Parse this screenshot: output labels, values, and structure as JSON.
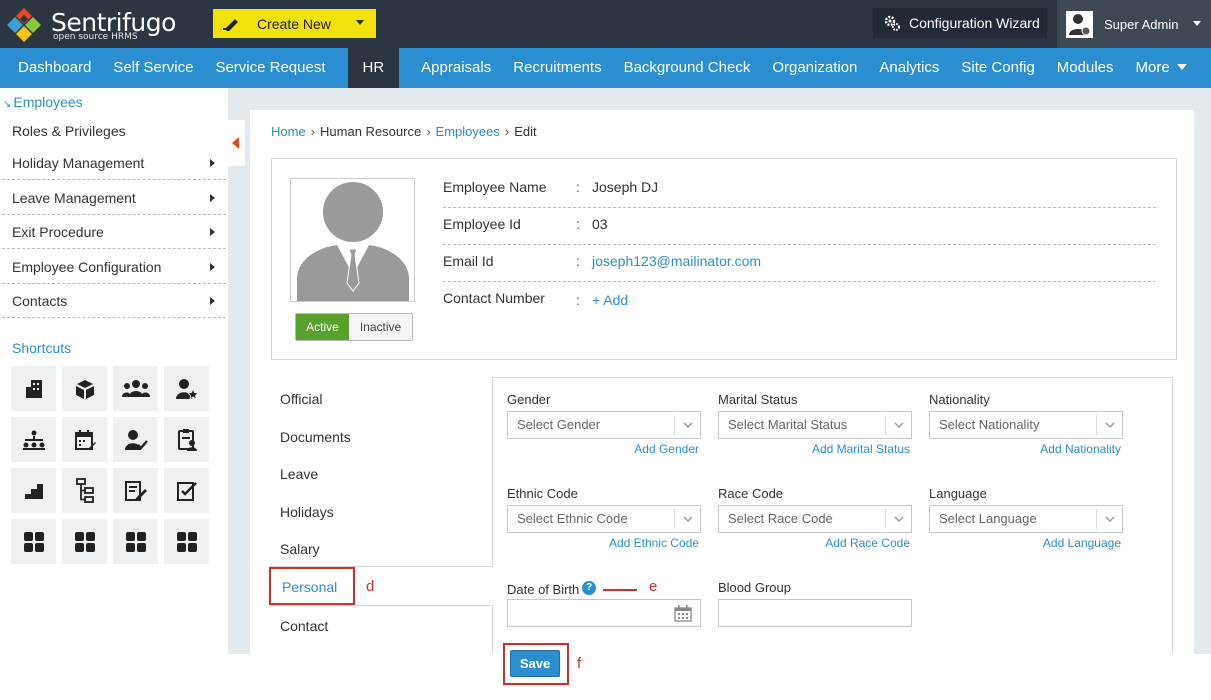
{
  "brand": {
    "name": "Sentrifugo",
    "tagline": "open source HRMS"
  },
  "header": {
    "create_new": "Create New",
    "config_wizard": "Configuration Wizard",
    "user_name": "Super Admin"
  },
  "nav": {
    "items": [
      "Dashboard",
      "Self Service",
      "Service Request",
      "HR",
      "Appraisals",
      "Recruitments",
      "Background Check",
      "Organization",
      "Analytics",
      "Site Config",
      "Modules",
      "More"
    ],
    "active": "HR"
  },
  "sidebar": {
    "section": "Employees",
    "items": [
      {
        "label": "Roles & Privileges",
        "has_submenu": false
      },
      {
        "label": "Holiday Management",
        "has_submenu": true
      },
      {
        "label": "Leave Management",
        "has_submenu": true
      },
      {
        "label": "Exit Procedure",
        "has_submenu": true
      },
      {
        "label": "Employee Configuration",
        "has_submenu": true
      },
      {
        "label": "Contacts",
        "has_submenu": true
      }
    ],
    "shortcuts_title": "Shortcuts",
    "shortcut_icons": [
      "building-icon",
      "boxes-icon",
      "group-icon",
      "user-star-icon",
      "org-chart-icon",
      "calendar-edit-icon",
      "user-check-icon",
      "clipboard-user-icon",
      "stairs-icon",
      "hierarchy-icon",
      "document-edit-icon",
      "checklist-icon",
      "grid-icon",
      "grid-icon",
      "grid-icon",
      "grid-icon"
    ]
  },
  "breadcrumb": {
    "home": "Home",
    "hr": "Human Resource",
    "employees": "Employees",
    "current": "Edit"
  },
  "employee": {
    "rows": [
      {
        "label": "Employee Name",
        "value": "Joseph DJ"
      },
      {
        "label": "Employee Id",
        "value": "03"
      },
      {
        "label": "Email Id",
        "value": "joseph123@mailinator.com"
      },
      {
        "label": "Contact Number",
        "value": "+ Add"
      }
    ],
    "colon": ":",
    "status_active": "Active",
    "status_inactive": "Inactive",
    "status": "Active"
  },
  "tabs": [
    "Official",
    "Documents",
    "Leave",
    "Holidays",
    "Salary",
    "Personal",
    "Contact"
  ],
  "active_tab": "Personal",
  "form": {
    "gender": {
      "label": "Gender",
      "placeholder": "Select Gender",
      "add": "Add Gender"
    },
    "marital": {
      "label": "Marital Status",
      "placeholder": "Select Marital Status",
      "add": "Add Marital Status"
    },
    "nationality": {
      "label": "Nationality",
      "placeholder": "Select Nationality",
      "add": "Add Nationality"
    },
    "ethnic": {
      "label": "Ethnic Code",
      "placeholder": "Select Ethnic Code",
      "add": "Add Ethnic Code"
    },
    "race": {
      "label": "Race Code",
      "placeholder": "Select Race Code",
      "add": "Add Race Code"
    },
    "language": {
      "label": "Language",
      "placeholder": "Select Language",
      "add": "Add Language"
    },
    "dob": {
      "label": "Date of Birth",
      "value": ""
    },
    "blood": {
      "label": "Blood Group",
      "value": ""
    },
    "save": "Save"
  },
  "annotations": {
    "d": "d",
    "e": "e",
    "f": "f"
  },
  "colors": {
    "nav_blue": "#2a8ed1",
    "header_dark": "#2b3642",
    "create_yellow": "#f1e30a",
    "active_green": "#5aa02c",
    "marker_red": "#d42b2b"
  }
}
